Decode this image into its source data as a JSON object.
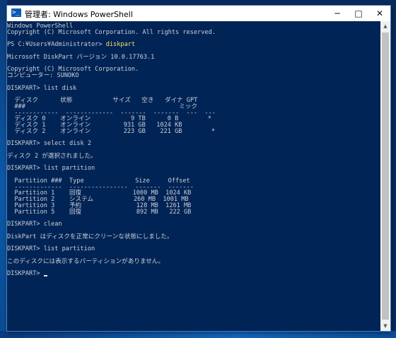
{
  "window": {
    "title": "管理者: Windows PowerShell",
    "icon_text": ">_",
    "minimize_glyph": "─",
    "maximize_glyph": "□",
    "close_glyph": "✕"
  },
  "console": {
    "lines": [
      {
        "text": "Windows PowerShell"
      },
      {
        "text": "Copyright (C) Microsoft Corporation. All rights reserved."
      },
      {
        "text": ""
      },
      {
        "text": "PS C:¥Users¥Administrator> ",
        "highlight": "diskpart"
      },
      {
        "text": ""
      },
      {
        "text": "Microsoft DiskPart バージョン 10.0.17763.1"
      },
      {
        "text": ""
      },
      {
        "text": "Copyright (C) Microsoft Corporation."
      },
      {
        "text": "コンピューター: SUNOKO"
      },
      {
        "text": ""
      },
      {
        "text": "DISKPART> list disk"
      },
      {
        "text": ""
      },
      {
        "text": "  ディスク      状態           サイズ   空き   ダイナ GPT"
      },
      {
        "text": "  ###                                          ミック"
      },
      {
        "text": "  ------------  -------------  -------  -------  ---  ---"
      },
      {
        "text": "  ディスク 0    オンライン           9 TB      0 B        *"
      },
      {
        "text": "  ディスク 1    オンライン         931 GB   1024 KB"
      },
      {
        "text": "  ディスク 2    オンライン         223 GB    221 GB        *"
      },
      {
        "text": ""
      },
      {
        "text": "DISKPART> select disk 2"
      },
      {
        "text": ""
      },
      {
        "text": "ディスク 2 が選択されました。"
      },
      {
        "text": ""
      },
      {
        "text": "DISKPART> list partition"
      },
      {
        "text": ""
      },
      {
        "text": "  Partition ###  Type              Size     Offset"
      },
      {
        "text": "  -------------  ----------------  -------  -------"
      },
      {
        "text": "  Partition 1    回復              1000 MB  1024 KB"
      },
      {
        "text": "  Partition 2    システム           260 MB  1001 MB"
      },
      {
        "text": "  Partition 3    予約               128 MB  1261 MB"
      },
      {
        "text": "  Partition 5    回復               892 MB   222 GB"
      },
      {
        "text": ""
      },
      {
        "text": "DISKPART> clean"
      },
      {
        "text": ""
      },
      {
        "text": "DiskPart はディスクを正常にクリーンな状態にしました。"
      },
      {
        "text": ""
      },
      {
        "text": "DISKPART> list partition"
      },
      {
        "text": ""
      },
      {
        "text": "このディスクには表示するパーティションがありません。"
      },
      {
        "text": ""
      },
      {
        "text": "DISKPART> "
      }
    ]
  },
  "scrollbar": {
    "up_glyph": "▲",
    "down_glyph": "▼"
  },
  "colors": {
    "console_background": "#012456",
    "console_text": "#ccd0d6",
    "command_highlight": "#f2e26b"
  }
}
